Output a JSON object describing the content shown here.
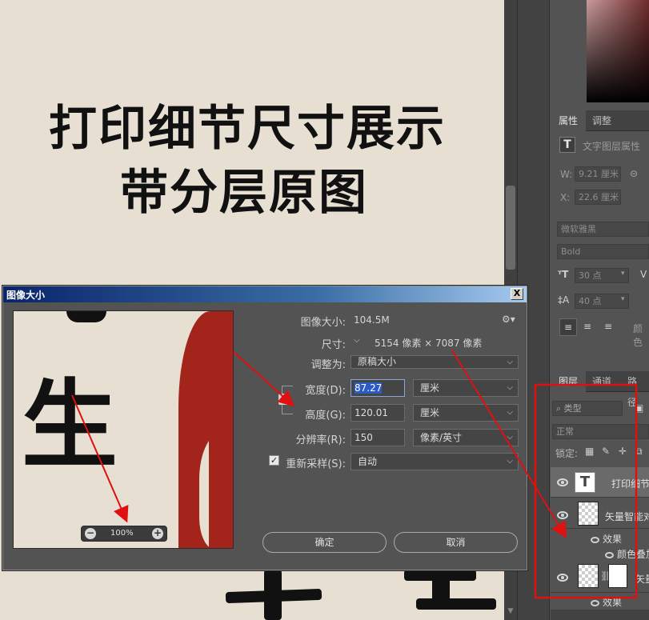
{
  "canvas": {
    "title_line1": "打印细节尺寸展示",
    "title_line2": "带分层原图"
  },
  "panels": {
    "properties": {
      "tab_active": "属性",
      "tab_other": "调整",
      "layer_type": "文字图层属性",
      "w_label": "W:",
      "w_value": "9.21 厘米",
      "x_label": "X:",
      "x_value": "22.6 厘米",
      "font_family": "微软雅黑",
      "font_style": "Bold",
      "font_size": "30 点",
      "leading": "40 点",
      "color_label": "颜色"
    },
    "layers": {
      "tab_active": "图层",
      "tab_channels": "通道",
      "tab_paths": "路径",
      "filter_kind": "类型",
      "blend_mode": "正常",
      "lock_label": "锁定:",
      "items": [
        {
          "name": "打印细节",
          "thumb": "T"
        },
        {
          "name": "矢量智能对象"
        },
        {
          "name": "效果"
        },
        {
          "name": "颜色叠加"
        },
        {
          "name": "矢量"
        },
        {
          "name": "效果"
        }
      ]
    }
  },
  "dialog": {
    "title": "图像大小",
    "close": "X",
    "image_size_label": "图像大小:",
    "image_size_value": "104.5M",
    "dimensions_label": "尺寸:",
    "dimensions_value": "5154 像素  ×  7087 像素",
    "fit_to_label": "调整为:",
    "fit_to_value": "原稿大小",
    "width_label": "宽度(D):",
    "width_value": "87.27",
    "width_unit": "厘米",
    "height_label": "高度(G):",
    "height_value": "120.01",
    "height_unit": "厘米",
    "resolution_label": "分辨率(R):",
    "resolution_value": "150",
    "resolution_unit": "像素/英寸",
    "resample_label": "重新采样(S):",
    "resample_value": "自动",
    "ok": "确定",
    "cancel": "取消",
    "preview_zoom": "100%",
    "preview_char": "生"
  },
  "colors": {
    "canvas_bg": "#e6dfd2",
    "accent_red": "#a3241a",
    "annotation": "#e01010",
    "panel_bg": "#535353",
    "titlebar": "#0a246a"
  }
}
